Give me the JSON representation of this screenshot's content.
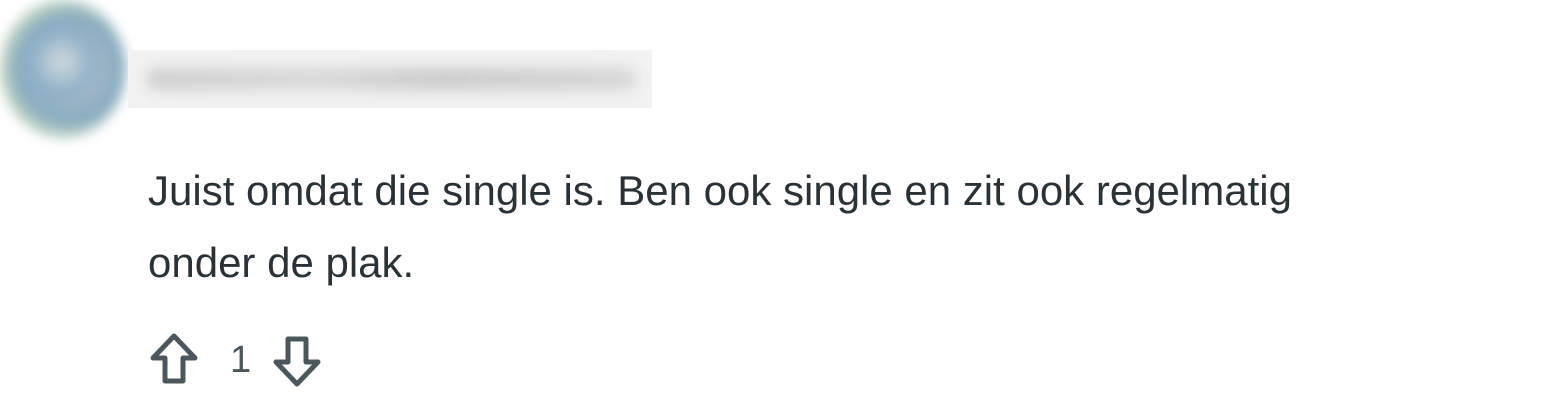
{
  "comment": {
    "author": {
      "avatar_icon": "user-avatar",
      "username_redacted": true
    },
    "body_lines": [
      "Juist omdat die single is. Ben ook single en zit ook regelmatig",
      "onder de plak."
    ],
    "votes": {
      "upvote_icon": "arrow-up-outline-icon",
      "count": "1",
      "downvote_icon": "arrow-down-outline-icon"
    }
  },
  "colors": {
    "text": "#2a3236",
    "muted": "#4c575d",
    "icon": "#4c575d",
    "background": "#ffffff",
    "redaction": "#f2f2f2"
  }
}
